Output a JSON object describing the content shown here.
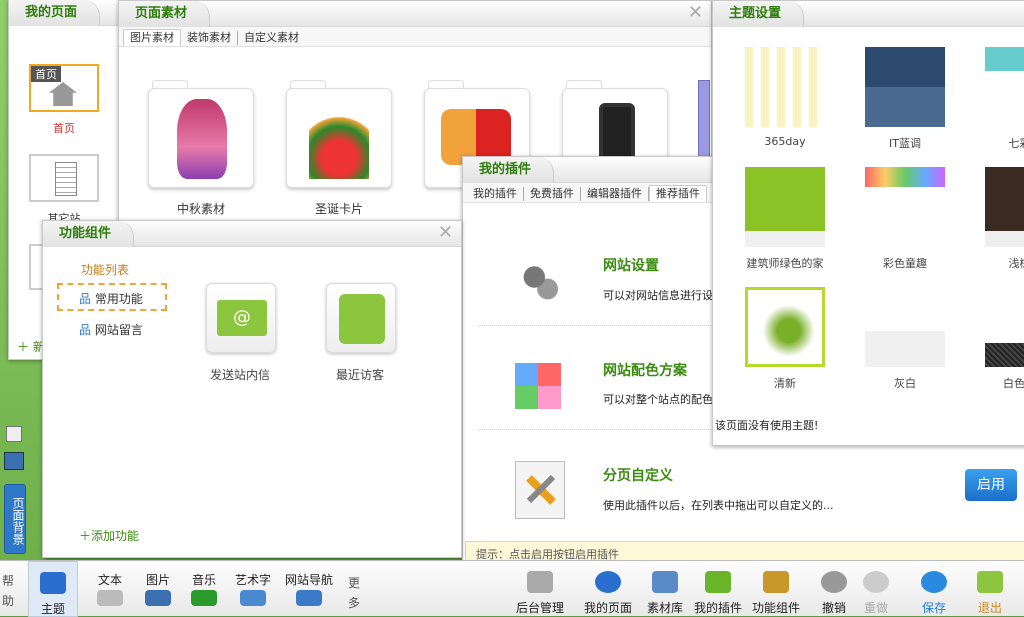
{
  "my_page": {
    "title": "我的页面",
    "pages": [
      {
        "label": "首页",
        "badge": "首页"
      },
      {
        "label": "其它站"
      }
    ],
    "add_label": "新"
  },
  "material": {
    "title": "页面素材",
    "tabs": [
      "图片素材",
      "装饰素材",
      "自定义素材"
    ],
    "items": [
      {
        "label": "中秋素材"
      },
      {
        "label": "圣诞卡片"
      }
    ]
  },
  "functions": {
    "title": "功能组件",
    "list_title": "功能列表",
    "tree": [
      "常用功能",
      "网站留言"
    ],
    "items": [
      {
        "label": "发送站内信"
      },
      {
        "label": "最近访客"
      }
    ],
    "add_label": "添加功能"
  },
  "plugins": {
    "title": "我的插件",
    "tabs": [
      "我的插件",
      "免费插件",
      "编辑器插件",
      "推荐插件"
    ],
    "items": [
      {
        "title": "网站设置",
        "desc": "可以对网站信息进行设"
      },
      {
        "title": "网站配色方案",
        "desc": "可以对整个站点的配色"
      },
      {
        "title": "分页自定义",
        "desc": "使用此插件以后，在列表中拖出可以自定义的..."
      }
    ],
    "tip": "提示：点击启用按钮启用插件",
    "enable_label": "启用"
  },
  "theme": {
    "title": "主题设置",
    "items": [
      {
        "label": "365day"
      },
      {
        "label": "IT蓝调"
      },
      {
        "label": "七彩白"
      },
      {
        "label": "建筑师绿色的家"
      },
      {
        "label": "彩色童趣"
      },
      {
        "label": "浅棕简"
      },
      {
        "label": "清新"
      },
      {
        "label": "灰白"
      },
      {
        "label": "白色与金"
      }
    ],
    "status": "该页面没有使用主题!"
  },
  "left_bar": {
    "help": "帮助",
    "page_bg": "页面背景"
  },
  "toolbar": {
    "left": [
      {
        "label": "主题"
      },
      {
        "label": "文本"
      },
      {
        "label": "图片"
      },
      {
        "label": "音乐"
      },
      {
        "label": "艺术字"
      },
      {
        "label": "网站导航"
      }
    ],
    "more": "更多",
    "right": [
      {
        "label": "后台管理"
      },
      {
        "label": "我的页面"
      },
      {
        "label": "素材库"
      },
      {
        "label": "我的插件"
      },
      {
        "label": "功能组件"
      },
      {
        "label": "撤销"
      },
      {
        "label": "重做"
      },
      {
        "label": "保存"
      },
      {
        "label": "退出"
      }
    ]
  },
  "colors": {
    "title_green": "#2f7d0b",
    "accent_blue": "#1a7fd6"
  }
}
